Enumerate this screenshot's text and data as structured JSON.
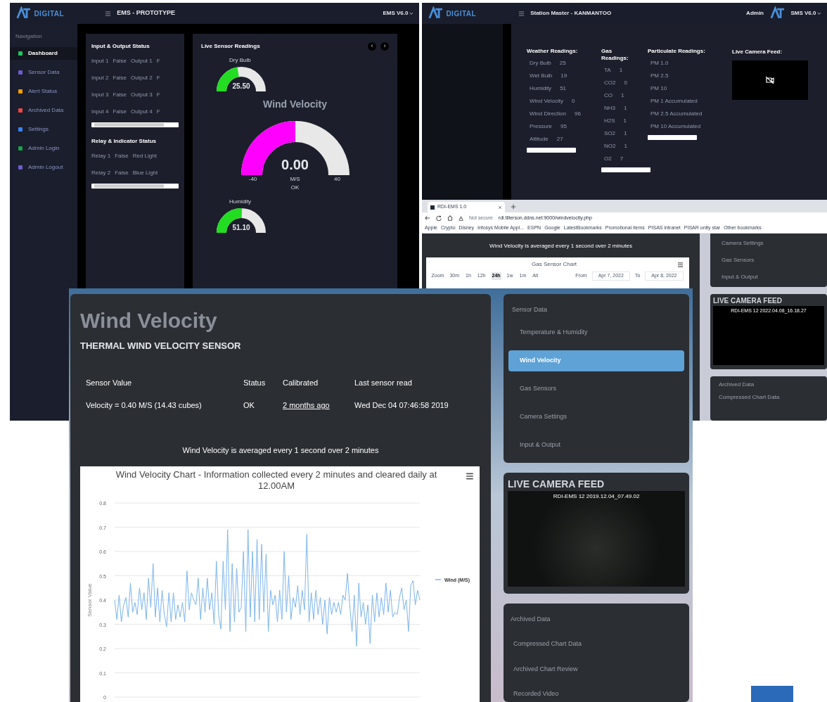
{
  "dashboard_window": {
    "logo": "DIGITAL",
    "title": "EMS - PROTOTYPE",
    "version": "EMS V6.0",
    "nav_heading": "Navigation",
    "nav": [
      {
        "label": "Dashboard",
        "color": "#22c55e",
        "selected": true
      },
      {
        "label": "Sensor Data",
        "color": "#6d5bd0",
        "selected": false
      },
      {
        "label": "Alert Status",
        "color": "#f59e0b",
        "selected": false
      },
      {
        "label": "Archived Data",
        "color": "#ef4444",
        "selected": false
      },
      {
        "label": "Settings",
        "color": "#3b82f6",
        "selected": false
      },
      {
        "label": "Admin Login",
        "color": "#16a34a",
        "selected": false
      },
      {
        "label": "Admin Logout",
        "color": "#6d5bd0",
        "selected": false
      }
    ],
    "io_panel": {
      "title": "Input & Output Status",
      "rows": [
        [
          "Input 1",
          "False",
          "Output 1",
          "F"
        ],
        [
          "Input 2",
          "False",
          "Output 2",
          "F"
        ],
        [
          "Input 3",
          "False",
          "Output 3",
          "F"
        ],
        [
          "Input 4",
          "False",
          "Output 4",
          "F"
        ]
      ]
    },
    "relay_panel": {
      "title": "Relay & Indicator Status",
      "rows": [
        [
          "Relay 1",
          "False",
          "Red Light"
        ],
        [
          "Relay 2",
          "False",
          "Blue Light"
        ]
      ]
    },
    "sensor_panel": {
      "title": "Live Sensor Readings",
      "prev": "‹",
      "next": "›",
      "gauges": [
        {
          "kind": "small",
          "label": "Dry Bulb",
          "value": "25.50",
          "level": 0.45,
          "color": "#22dd22"
        },
        {
          "kind": "large",
          "label": "Wind Velocity",
          "value": "0.00",
          "level": 0.5,
          "color": "#ff00ff",
          "min": "-40",
          "max": "40",
          "unit": "M/S",
          "status": "OK"
        },
        {
          "kind": "small",
          "label": "Humidity",
          "value": "51.10",
          "level": 0.51,
          "color": "#22dd22"
        }
      ]
    }
  },
  "station_window": {
    "logo": "DIGITAL",
    "title": "Station Master - KANMANTOO",
    "user": "Admin",
    "version": "SMS V6.0",
    "weather": {
      "title": "Weather Readings:",
      "rows": [
        [
          "Dry Bulb",
          "25"
        ],
        [
          "Wet Bulb",
          "19"
        ],
        [
          "Humidity",
          "51"
        ],
        [
          "Wind Velocity",
          "0"
        ],
        [
          "Wind Direction",
          "96"
        ],
        [
          "Pressure",
          "95"
        ],
        [
          "Altitude",
          "27"
        ]
      ]
    },
    "gas": {
      "title": "Gas Readings:",
      "rows": [
        [
          "TA",
          "1"
        ],
        [
          "CO2",
          "0"
        ],
        [
          "CO",
          "1"
        ],
        [
          "NH3",
          "1"
        ],
        [
          "H2S",
          "1"
        ],
        [
          "SO2",
          "1"
        ],
        [
          "NO2",
          "1"
        ],
        [
          "O2",
          "7"
        ]
      ]
    },
    "particulate": {
      "title": "Particulate Readings:",
      "rows": [
        [
          "PM 1.0"
        ],
        [
          "PM 2.5"
        ],
        [
          "PM 10"
        ],
        [
          "PM 1 Accumulated"
        ],
        [
          "PM 2.5 Accumulated"
        ],
        [
          "PM 10 Accumulated"
        ]
      ]
    },
    "camera": {
      "title": "Live Camera Feed:"
    }
  },
  "browser_window": {
    "tab": "RDI-EMS 1.0",
    "security": "Not secure",
    "url": "rdi.tillerson.ddns.net:9000/windvelocity.php",
    "bookmarks": [
      "Apple",
      "Crypto",
      "Disney",
      "Infosys Mobile Appl...",
      "ESPN",
      "Google",
      "LatestBookmarks",
      "Promotional items",
      "PISAS intranet",
      "PISAR unity star",
      "Other bookmarks"
    ],
    "note": "Wind Velocity is averaged every 1 second over 2 minutes",
    "gas_chart": {
      "title": "Gas Sensor Chart",
      "zoom_label": "Zoom",
      "ranges": [
        {
          "label": "30m",
          "selected": false
        },
        {
          "label": "1h",
          "selected": false
        },
        {
          "label": "12h",
          "selected": false
        },
        {
          "label": "24h",
          "selected": true
        },
        {
          "label": "1w",
          "selected": false
        },
        {
          "label": "1m",
          "selected": false
        },
        {
          "label": "All",
          "selected": false
        }
      ],
      "from_label": "From",
      "from": "Apr 7, 2022",
      "to_label": "To",
      "to": "Apr 8, 2022"
    },
    "menu": [
      "Camera Settings",
      "Gas Sensors",
      "Input & Output"
    ],
    "camera": {
      "title": "LIVE CAMERA FEED",
      "stamp": "RDI-EMS 12 2022.04.08_16.18.27"
    },
    "archived": {
      "title": "Archived Data",
      "items": [
        "Compressed Chart Data"
      ]
    }
  },
  "sensor_window": {
    "title": "Wind Velocity",
    "subtitle": "THERMAL WIND VELOCITY SENSOR",
    "columns": [
      "Sensor Value",
      "Status",
      "Calibrated",
      "Last sensor read"
    ],
    "row": [
      "Velocity = 0.40 M/S (14.43 cubes)",
      "OK",
      "2 months ago",
      "Wed Dec 04 07:46:58 2019"
    ],
    "note": "Wind Velocity is averaged every 1 second over 2 minutes",
    "chart": {
      "chart_data": {
        "type": "line",
        "title": "Wind Velocity Chart - Information collected every 2 minutes and cleared daily at 12.00AM",
        "ylabel": "Sensor Value",
        "ylim": [
          0,
          0.8
        ],
        "yticks": [
          0,
          0.1,
          0.2,
          0.3,
          0.4,
          0.5,
          0.6,
          0.7,
          0.8
        ],
        "grid": true,
        "series": [
          {
            "name": "Wind (M/S)",
            "color": "#7cb5ec",
            "values": [
              0.4,
              0.32,
              0.42,
              0.31,
              0.38,
              0.41,
              0.33,
              0.47,
              0.35,
              0.39,
              0.34,
              0.45,
              0.36,
              0.43,
              0.32,
              0.49,
              0.37,
              0.55,
              0.33,
              0.45,
              0.31,
              0.44,
              0.34,
              0.29,
              0.43,
              0.31,
              0.43,
              0.32,
              0.38,
              0.33,
              0.39,
              0.31,
              0.52,
              0.36,
              0.43,
              0.4,
              0.38,
              0.49,
              0.32,
              0.45,
              0.35,
              0.49,
              0.36,
              0.43,
              0.3,
              0.56,
              0.34,
              0.28,
              0.56,
              0.36,
              0.69,
              0.27,
              0.55,
              0.31,
              0.53,
              0.35,
              0.37,
              0.6,
              0.27,
              0.69,
              0.33,
              0.6,
              0.31,
              0.65,
              0.32,
              0.63,
              0.35,
              0.59,
              0.27,
              0.44,
              0.38,
              0.42,
              0.31,
              0.44,
              0.32,
              0.6,
              0.35,
              0.5,
              0.32,
              0.41,
              0.37,
              0.46,
              0.34,
              0.44,
              0.36,
              0.67,
              0.31,
              0.43,
              0.32,
              0.44,
              0.34,
              0.41,
              0.3,
              0.4,
              0.26,
              0.41,
              0.34,
              0.39,
              0.35,
              0.39,
              0.34,
              0.42,
              0.4,
              0.51,
              0.38,
              0.27,
              0.42,
              0.21,
              0.47,
              0.33,
              0.39,
              0.3,
              0.38,
              0.22,
              0.42,
              0.31,
              0.43,
              0.33,
              0.41,
              0.34,
              0.47,
              0.35,
              0.44,
              0.33,
              0.35,
              0.34,
              0.41,
              0.45,
              0.36,
              0.4,
              0.27,
              0.46,
              0.48,
              0.38,
              0.44,
              0.4
            ]
          }
        ]
      }
    },
    "menu_heading": "Sensor Data",
    "menu": [
      {
        "label": "Temperature & Humidity",
        "selected": false
      },
      {
        "label": "Wind Velocity",
        "selected": true
      },
      {
        "label": "Gas Sensors",
        "selected": false
      },
      {
        "label": "Camera Settings",
        "selected": false
      },
      {
        "label": "Input & Output",
        "selected": false
      }
    ],
    "camera": {
      "title": "LIVE CAMERA FEED",
      "stamp": "RDI-EMS 12 2019.12.04_07.49.02"
    },
    "archived": {
      "title": "Archived Data",
      "items": [
        "Compressed Chart Data",
        "Archived Chart Review",
        "Recorded Video"
      ]
    }
  }
}
